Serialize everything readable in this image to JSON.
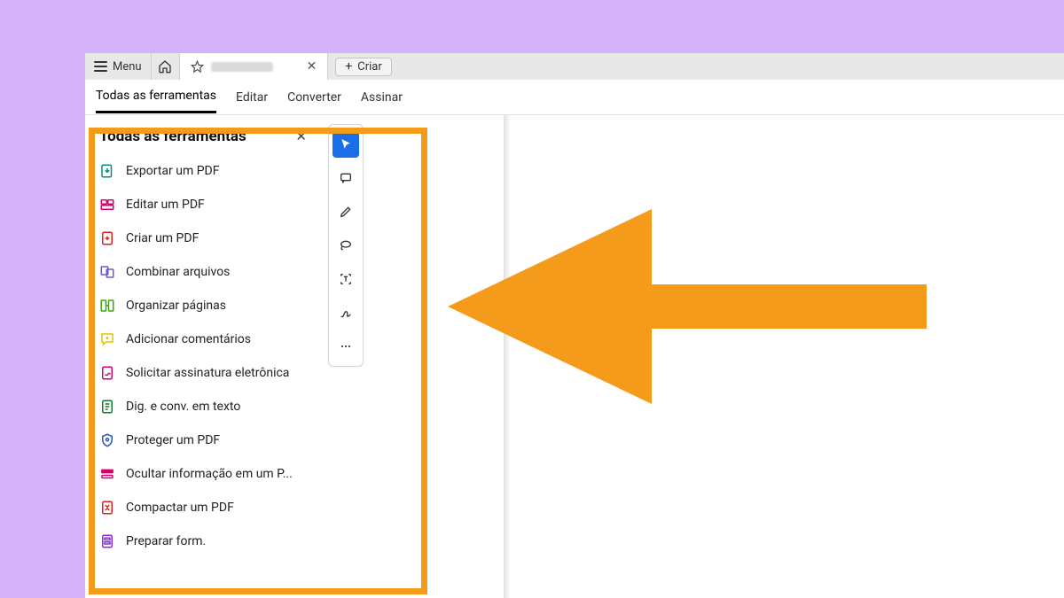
{
  "titlebar": {
    "menu_label": "Menu",
    "create_label": "Criar"
  },
  "toolsrow": {
    "tabs": [
      {
        "label": "Todas as ferramentas",
        "active": true
      },
      {
        "label": "Editar",
        "active": false
      },
      {
        "label": "Converter",
        "active": false
      },
      {
        "label": "Assinar",
        "active": false
      }
    ]
  },
  "sidebar": {
    "title": "Todas as ferramentas",
    "items": [
      {
        "icon": "export-pdf-icon",
        "color": "#008f7a",
        "label": "Exportar um PDF"
      },
      {
        "icon": "edit-pdf-icon",
        "color": "#d6006c",
        "label": "Editar um PDF"
      },
      {
        "icon": "create-pdf-icon",
        "color": "#e01e1e",
        "label": "Criar um PDF"
      },
      {
        "icon": "combine-icon",
        "color": "#6a5acd",
        "label": "Combinar arquivos"
      },
      {
        "icon": "organize-icon",
        "color": "#3fa110",
        "label": "Organizar páginas"
      },
      {
        "icon": "comment-icon",
        "color": "#e6c200",
        "label": "Adicionar comentários"
      },
      {
        "icon": "request-sign-icon",
        "color": "#d6006c",
        "label": "Solicitar assinatura eletrônica"
      },
      {
        "icon": "ocr-icon",
        "color": "#127a2b",
        "label": "Dig. e conv. em texto"
      },
      {
        "icon": "protect-icon",
        "color": "#3350c8",
        "label": "Proteger um PDF"
      },
      {
        "icon": "redact-icon",
        "color": "#d6006c",
        "label": "Ocultar informação em um P..."
      },
      {
        "icon": "compress-icon",
        "color": "#e01e1e",
        "label": "Compactar um PDF"
      },
      {
        "icon": "form-icon",
        "color": "#8a2be2",
        "label": "Preparar form."
      }
    ]
  },
  "quickbar": {
    "items": [
      {
        "icon": "cursor-icon",
        "selected": true
      },
      {
        "icon": "comment-bubble-icon",
        "selected": false
      },
      {
        "icon": "pencil-icon",
        "selected": false
      },
      {
        "icon": "lasso-icon",
        "selected": false
      },
      {
        "icon": "text-select-icon",
        "selected": false
      },
      {
        "icon": "sign-icon",
        "selected": false
      },
      {
        "icon": "more-icon",
        "selected": false
      }
    ]
  }
}
